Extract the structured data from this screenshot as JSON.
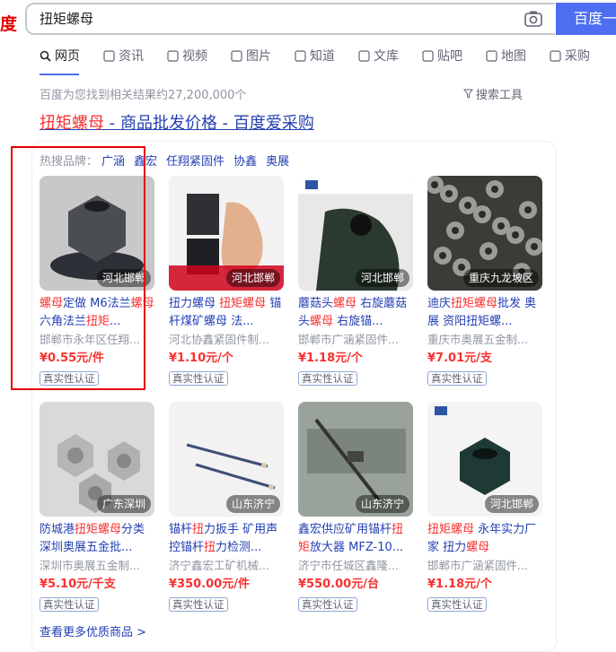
{
  "logo_text": "度",
  "search": {
    "query": "扭矩螺母",
    "button_label": "百度一"
  },
  "tabs": [
    {
      "label": "网页",
      "icon": "search-icon"
    },
    {
      "label": "资讯",
      "icon": "news-icon"
    },
    {
      "label": "视频",
      "icon": "video-icon"
    },
    {
      "label": "图片",
      "icon": "image-icon"
    },
    {
      "label": "知道",
      "icon": "question-icon"
    },
    {
      "label": "文库",
      "icon": "doc-icon"
    },
    {
      "label": "贴吧",
      "icon": "forum-icon"
    },
    {
      "label": "地图",
      "icon": "map-icon"
    },
    {
      "label": "采购",
      "icon": "cart-icon"
    }
  ],
  "result_count": "百度为您找到相关结果约27,200,000个",
  "tools_label": "搜索工具",
  "result": {
    "title_hl": "扭矩螺母",
    "title_rest": " - 商品批发价格 - 百度爱采购",
    "brands_label": "热搜品牌：",
    "brands": [
      "广涵",
      "鑫宏",
      "任翔紧固件",
      "协鑫",
      "奥展"
    ]
  },
  "products": [
    {
      "name_parts": [
        [
          "螺母",
          1
        ],
        [
          "定做 M6法兰",
          0
        ],
        [
          "螺母",
          1
        ],
        [
          "六角法兰",
          0
        ],
        [
          "扭矩",
          1
        ],
        [
          "...",
          0
        ]
      ],
      "shop": "邯郸市永年区任翔...",
      "price": "¥0.55元/件",
      "badge": "真实性认证",
      "location": "河北邯郸",
      "thumb": "nut-gray"
    },
    {
      "name_parts": [
        [
          "扭力螺母 ",
          0
        ],
        [
          "扭矩螺母",
          1
        ],
        [
          " 锚杆煤矿螺母 法...",
          0
        ]
      ],
      "shop": "河北协鑫紧固件制...",
      "price": "¥1.10元/个",
      "badge": "真实性认证",
      "location": "河北邯郸",
      "thumb": "nut-thumb"
    },
    {
      "name_parts": [
        [
          "蘑菇头",
          0
        ],
        [
          "螺母",
          1
        ],
        [
          " 右旋蘑菇头",
          0
        ],
        [
          "螺母",
          1
        ],
        [
          " 右旋锚...",
          0
        ]
      ],
      "shop": "邯郸市广涵紧固件...",
      "price": "¥1.18元/个",
      "badge": "真实性认证",
      "location": "河北邯郸",
      "thumb": "glove"
    },
    {
      "name_parts": [
        [
          "迪庆",
          0
        ],
        [
          "扭矩螺母",
          1
        ],
        [
          "批发 奥展 资阳扭矩螺...",
          0
        ]
      ],
      "shop": "重庆市奥展五金制...",
      "price": "¥7.01元/支",
      "badge": "真实性认证",
      "location": "重庆九龙坡区",
      "thumb": "pile"
    },
    {
      "name_parts": [
        [
          "防城港",
          0
        ],
        [
          "扭矩螺母",
          1
        ],
        [
          "分类 深圳奥展五金批...",
          0
        ]
      ],
      "shop": "深圳市奥展五金制...",
      "price": "¥5.10元/千支",
      "badge": "真实性认证",
      "location": "广东深圳",
      "thumb": "hexnuts"
    },
    {
      "name_parts": [
        [
          "锚杆",
          0
        ],
        [
          "扭",
          1
        ],
        [
          "力扳手 矿用声控锚杆",
          0
        ],
        [
          "扭",
          1
        ],
        [
          "力检测...",
          0
        ]
      ],
      "shop": "济宁鑫宏工矿机械...",
      "price": "¥350.00元/件",
      "badge": "真实性认证",
      "location": "山东济宁",
      "thumb": "rods"
    },
    {
      "name_parts": [
        [
          "鑫宏供应矿用锚杆",
          0
        ],
        [
          "扭",
          1
        ],
        [
          "矩",
          1
        ],
        [
          "放大器 MFZ-10...",
          0
        ]
      ],
      "shop": "济宁市任城区鑫隆...",
      "price": "¥550.00元/台",
      "badge": "真实性认证",
      "location": "山东济宁",
      "thumb": "tool"
    },
    {
      "name_parts": [
        [
          "扭矩螺母",
          1
        ],
        [
          " 永年实力厂家 扭力",
          0
        ],
        [
          "螺母",
          1
        ]
      ],
      "shop": "邯郸市广涵紧固件...",
      "price": "¥1.18元/个",
      "badge": "真实性认证",
      "location": "河北邯郸",
      "thumb": "nut-dark"
    }
  ],
  "more_link": "查看更多优质商品 >"
}
